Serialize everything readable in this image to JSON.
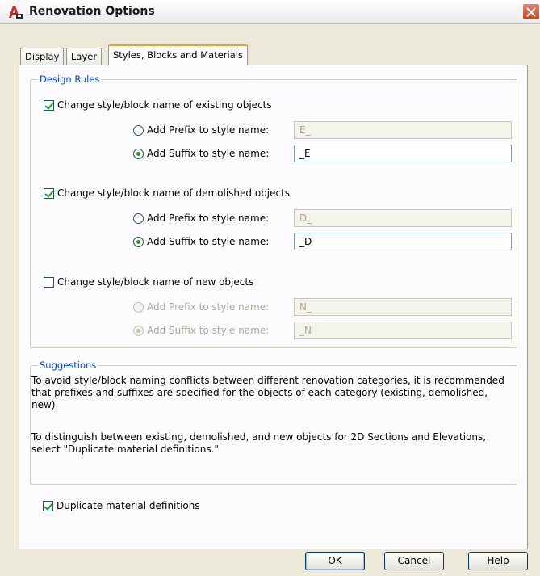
{
  "window": {
    "title": "Renovation Options",
    "colors": {
      "group_heading": "#0046d5",
      "active_tab_accent": "#e9a52b",
      "check_mark": "#21a121"
    }
  },
  "tabs": [
    {
      "label": "Display",
      "active": false
    },
    {
      "label": "Layer",
      "active": false
    },
    {
      "label": "Styles, Blocks and Materials",
      "active": true
    }
  ],
  "design_rules": {
    "heading": "Design Rules",
    "sections": [
      {
        "checkbox_label": "Change style/block name of existing objects",
        "checked": true,
        "prefix_label": "Add Prefix to style name:",
        "prefix_value": "E_",
        "suffix_label": "Add Suffix to style name:",
        "suffix_value": "_E",
        "selected_option": "suffix"
      },
      {
        "checkbox_label": "Change style/block name of demolished objects",
        "checked": true,
        "prefix_label": "Add Prefix to style name:",
        "prefix_value": "D_",
        "suffix_label": "Add Suffix to style name:",
        "suffix_value": "_D",
        "selected_option": "suffix"
      },
      {
        "checkbox_label": "Change style/block name of new objects",
        "checked": false,
        "prefix_label": "Add Prefix to style name:",
        "prefix_value": "N_",
        "suffix_label": "Add Suffix to style name:",
        "suffix_value": "_N",
        "selected_option": "suffix"
      }
    ]
  },
  "suggestions": {
    "heading": "Suggestions",
    "para1_line1": "To avoid style/block naming conflicts between different renovation categories, it is recommended",
    "para1_line2": "that prefixes and suffixes are specified for the objects of each category (existing, demolished,",
    "para1_line3": "new).",
    "para2_line1": "To distinguish between existing, demolished, and new objects for 2D Sections and Elevations,",
    "para2_line2": "select \"Duplicate material definitions.\""
  },
  "duplicate_materials": {
    "label": "Duplicate material definitions",
    "checked": true
  },
  "buttons": {
    "ok": "OK",
    "cancel": "Cancel",
    "help": "Help"
  }
}
